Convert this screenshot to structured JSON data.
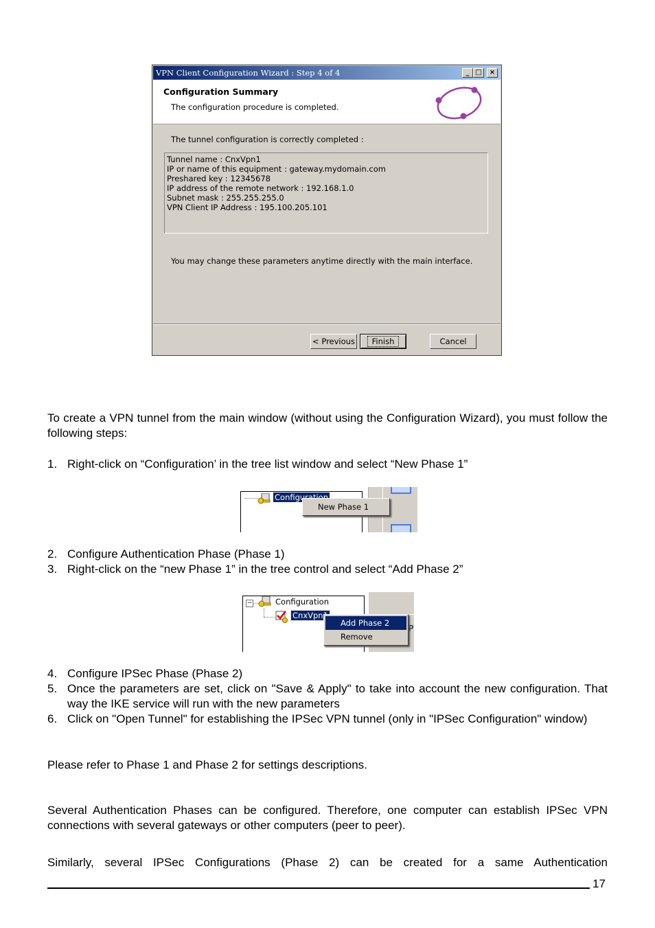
{
  "dialog": {
    "title": "VPN Client Configuration Wizard : Step 4 of 4",
    "title_buttons": {
      "minimize": "_",
      "maximize": "□",
      "close": "×"
    },
    "header_title": "Configuration Summary",
    "header_subtitle": "The configuration procedure is completed.",
    "header_icon": "network-ring-icon",
    "tunnel_label": "The tunnel configuration is correctly completed :",
    "summary_lines": [
      "Tunnel name : CnxVpn1",
      "IP or name of this equipment : gateway.mydomain.com",
      "Preshared key : 12345678",
      "IP address of the remote network : 192.168.1.0",
      "Subnet mask : 255.255.255.0",
      "VPN Client IP Address : 195.100.205.101"
    ],
    "change_note": "You may change these parameters anytime directly with the main interface.",
    "buttons": {
      "previous": "< Previous",
      "finish": "Finish",
      "cancel": "Cancel"
    },
    "accent_color": "#0a246a",
    "icon_color": "#9b3fa3"
  },
  "intro": "To create a VPN tunnel from the main window (without using the Configuration Wizard), you must follow the following steps:",
  "steps": [
    {
      "num": "1.",
      "text": "Right-click on “Configuration’ in the tree list window and select “New Phase 1”"
    },
    {
      "num": "2.",
      "text": "Configure Authentication Phase (Phase 1)"
    },
    {
      "num": "3.",
      "text": "Right-click on the “new Phase 1” in the tree control and select “Add Phase 2”"
    },
    {
      "num": "4.",
      "text": "Configure IPSec Phase (Phase 2)"
    },
    {
      "num": "5.",
      "text": "Once the parameters are set, click on \"Save & Apply\" to take into account the new configuration. That way the IKE service will run with the new parameters"
    },
    {
      "num": "6.",
      "text": "Click on \"Open Tunnel\" for establishing the IPSec VPN tunnel (only in \"IPSec Configuration\" window)"
    }
  ],
  "shot1": {
    "tree_node": "Configuration",
    "menu_items": [
      "New Phase 1"
    ]
  },
  "shot2": {
    "tree_root": "Configuration",
    "tree_child": "CnxVpn1",
    "menu_items": [
      "Add Phase 2",
      "Remove"
    ],
    "panel_letter": "P"
  },
  "refer": "Please refer to Phase 1 and Phase 2 for settings descriptions.",
  "para_several": "Several Authentication Phases can be configured. Therefore, one computer can establish IPSec VPN connections with several gateways or other computers (peer to peer).",
  "para_similarly": "Similarly, several IPSec Configurations (Phase 2) can be created for a same Authentication",
  "page_number": "17"
}
